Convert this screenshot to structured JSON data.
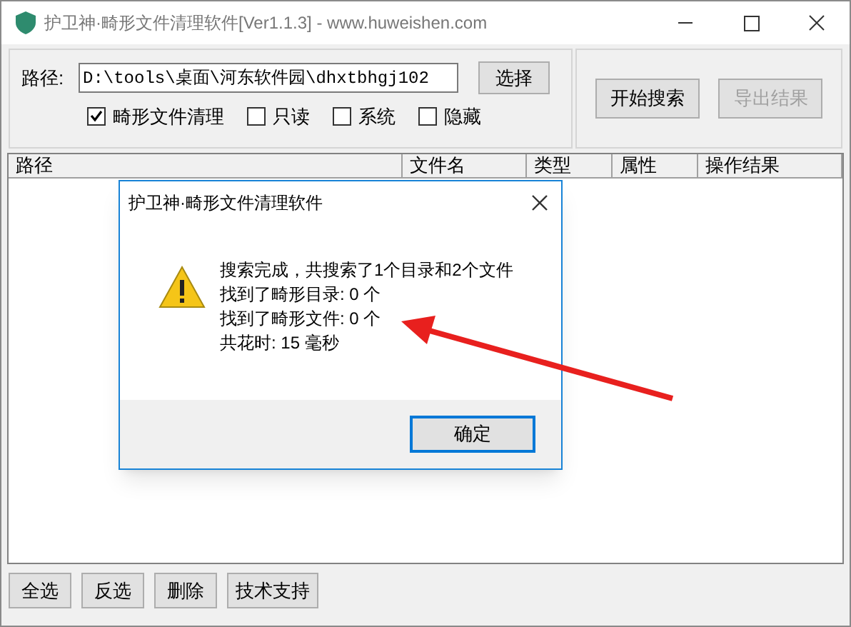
{
  "window": {
    "title": "护卫神·畸形文件清理软件[Ver1.1.3] - www.huweishen.com"
  },
  "path": {
    "label": "路径:",
    "value": "D:\\tools\\桌面\\河东软件园\\dhxtbhgj102",
    "button": "选择"
  },
  "filters": [
    {
      "label": "畸形文件清理",
      "checked": true
    },
    {
      "label": "只读",
      "checked": false
    },
    {
      "label": "系统",
      "checked": false
    },
    {
      "label": "隐藏",
      "checked": false
    }
  ],
  "actions": [
    {
      "label": "开始搜索",
      "disabled": false
    },
    {
      "label": "导出结果",
      "disabled": true
    }
  ],
  "table": {
    "columns": [
      "路径",
      "文件名",
      "类型",
      "属性",
      "操作结果"
    ]
  },
  "bottom_buttons": [
    "全选",
    "反选",
    "删除",
    "技术支持"
  ],
  "dialog": {
    "title": "护卫神·畸形文件清理软件",
    "lines": [
      "搜索完成，共搜索了1个目录和2个文件",
      "找到了畸形目录: 0 个",
      "找到了畸形文件: 0 个",
      "共花时: 15 毫秒"
    ],
    "button": "确定"
  }
}
